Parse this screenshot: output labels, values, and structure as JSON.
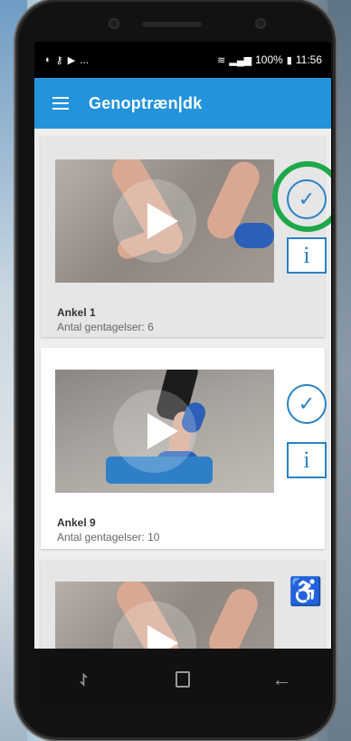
{
  "status_bar": {
    "left_icons": [
      "circle-icon",
      "key-icon",
      "play-store-icon"
    ],
    "ellipsis": "...",
    "battery": "100%",
    "time": "11:56"
  },
  "app_bar": {
    "title": "Genoptræn|dk"
  },
  "exercises": [
    {
      "name": "Ankel 1",
      "reps": "Antal gentagelser: 6",
      "completed": true
    },
    {
      "name": "Ankel 9",
      "reps": "Antal gentagelser: 10",
      "completed": true
    },
    {
      "name": "",
      "reps": "",
      "completed": false
    }
  ],
  "buttons": {
    "check_symbol": "✓",
    "info_symbol": "i"
  },
  "colors": {
    "app_bar": "#2393dc",
    "accent": "#2a82c8",
    "highlight_ring": "#1fa84a"
  },
  "nav_bar": {
    "icons": [
      "recent-apps-icon",
      "home-icon",
      "back-icon"
    ]
  }
}
